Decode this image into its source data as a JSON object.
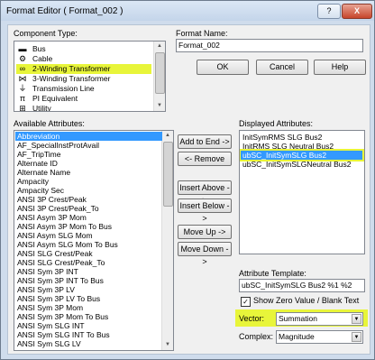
{
  "window": {
    "title": "Format Editor ( Format_002 )",
    "help_button": "?",
    "close_button": "X"
  },
  "component_type": {
    "label": "Component Type:",
    "items": [
      {
        "label": "Bus",
        "icon": "bus-icon"
      },
      {
        "label": "Cable",
        "icon": "cable-icon"
      },
      {
        "label": "2-Winding Transformer",
        "icon": "two-winding-transformer-icon",
        "selected": true
      },
      {
        "label": "3-Winding Transformer",
        "icon": "three-winding-transformer-icon"
      },
      {
        "label": "Transmission Line",
        "icon": "transmission-line-icon"
      },
      {
        "label": "PI Equivalent",
        "icon": "pi-equivalent-icon"
      },
      {
        "label": "Utility",
        "icon": "utility-icon"
      }
    ]
  },
  "format_name": {
    "label": "Format Name:",
    "value": "Format_002"
  },
  "buttons": {
    "ok": "OK",
    "cancel": "Cancel",
    "help": "Help",
    "add_to_end": "Add to End ->",
    "remove": "<- Remove",
    "insert_above": "Insert Above ->",
    "insert_below": "Insert Below ->",
    "move_up": "Move Up ->",
    "move_down": "Move Down ->"
  },
  "available_attributes": {
    "label": "Available Attributes:",
    "items": [
      "Abbreviation",
      "AF_SpecialInstProtAvail",
      "AF_TripTime",
      "Alternate ID",
      "Alternate Name",
      "Ampacity",
      "Ampacity Sec",
      "ANSI 3P Crest/Peak",
      "ANSI 3P Crest/Peak_To",
      "ANSI Asym 3P Mom",
      "ANSI Asym 3P Mom To Bus",
      "ANSI Asym SLG Mom",
      "ANSI Asym SLG Mom To Bus",
      "ANSI SLG Crest/Peak",
      "ANSI SLG Crest/Peak_To",
      "ANSI Sym 3P INT",
      "ANSI Sym 3P INT To Bus",
      "ANSI Sym 3P LV",
      "ANSI Sym 3P LV To Bus",
      "ANSI Sym 3P Mom",
      "ANSI Sym 3P Mom To Bus",
      "ANSI Sym SLG INT",
      "ANSI Sym SLG INT To Bus",
      "ANSI Sym SLG LV"
    ],
    "selected_index": 0
  },
  "displayed_attributes": {
    "label": "Displayed Attributes:",
    "items": [
      "InitSymRMS SLG Bus2",
      "InitRMS SLG Neutral Bus2",
      "ubSC_InitSymSLG Bus2",
      "ubSC_InitSymSLGNeutral Bus2"
    ],
    "selected_index": 2
  },
  "attribute_template": {
    "label": "Attribute Template:",
    "value": "ubSC_InitSymSLG Bus2 %1 %2"
  },
  "show_zero": {
    "label": "Show Zero Value / Blank Text",
    "checked": true
  },
  "vector": {
    "label": "Vector:",
    "value": "Summation"
  },
  "complex": {
    "label": "Complex:",
    "value": "Magnitude"
  },
  "colors": {
    "highlight": "#e8f53a",
    "selection": "#3399ff"
  }
}
